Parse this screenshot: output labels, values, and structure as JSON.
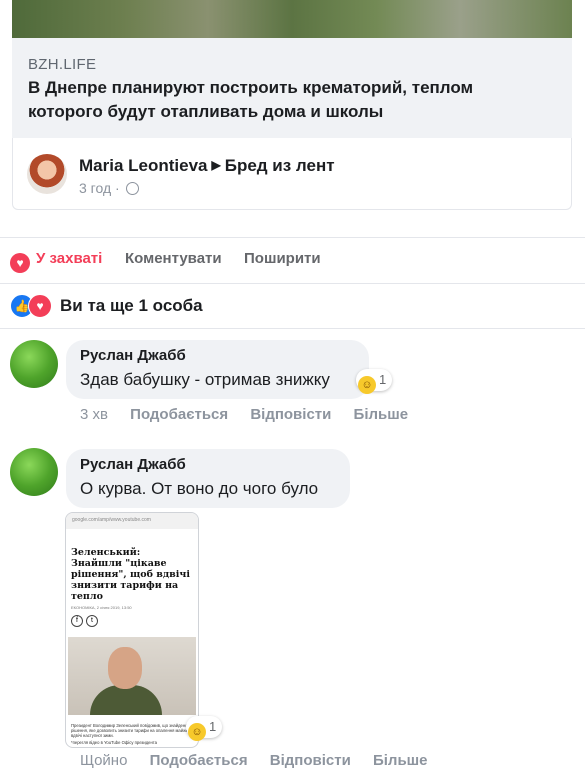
{
  "link_preview": {
    "domain": "BZH.LIFE",
    "headline": "В Днепре планируют построить крематорий, теплом которого будут отапливать дома и школы"
  },
  "share": {
    "author": "Maria Leontieva",
    "group": "Бред из лент",
    "time": "3 год ·"
  },
  "actions": {
    "like_label": "У захваті",
    "comment_label": "Коментувати",
    "share_label": "Поширити",
    "like_color": "#f33e58"
  },
  "reactions": {
    "summary": "Ви та ще 1 особа"
  },
  "comments": [
    {
      "author": "Руслан Джабб",
      "text": "Здав бабушку - отримав знижку",
      "reaction_count": "1",
      "time": "3 хв",
      "like_label": "Подобається",
      "reply_label": "Відповісти",
      "more_label": "Більше"
    },
    {
      "author": "Руслан Джабб",
      "text": "О курва. От воно до чого було",
      "reaction_count": "1",
      "time": "Щойно",
      "like_label": "Подобається",
      "reply_label": "Відповісти",
      "more_label": "Більше",
      "attachment": {
        "url_bar": "google.com/amp/www.youtube.com",
        "headline": "Зеленський: Знайшли \"цікаве рішення\", щоб вдвічі знизити тарифи на тепло",
        "byline": "ЕКОНОМІКА, 2 січня 2019, 13:50",
        "caption": "Президент Володимир Зеленський повідомив, що знайдено рішення, яке дозволить знизити тарифи на опалення майже вдвічі наступної зими.",
        "video_note": "*перегля відео в YouTube Офісу президента"
      }
    }
  ]
}
